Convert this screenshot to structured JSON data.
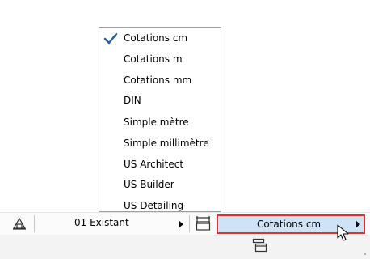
{
  "dimension_menu": {
    "items": [
      {
        "label": "Cotations cm",
        "checked": true
      },
      {
        "label": "Cotations m",
        "checked": false
      },
      {
        "label": "Cotations mm",
        "checked": false
      },
      {
        "label": "DIN",
        "checked": false
      },
      {
        "label": "Simple mètre",
        "checked": false
      },
      {
        "label": "Simple millimètre",
        "checked": false
      },
      {
        "label": "US Architect",
        "checked": false
      },
      {
        "label": "US Builder",
        "checked": false
      },
      {
        "label": "US Detailing",
        "checked": false
      }
    ]
  },
  "statusbar": {
    "renovation_filter": "01 Existant",
    "dimension_standard": "Cotations cm"
  },
  "icons": {
    "layer": "layer-icon",
    "dimension": "dimension-icon",
    "window_layout": "window-layout-icon",
    "check": "checkmark-icon",
    "cursor": "mouse-pointer-icon"
  },
  "colors": {
    "selection_bg": "#cfe3f7",
    "highlight_border": "#d9342b",
    "check": "#1f5fa8"
  }
}
